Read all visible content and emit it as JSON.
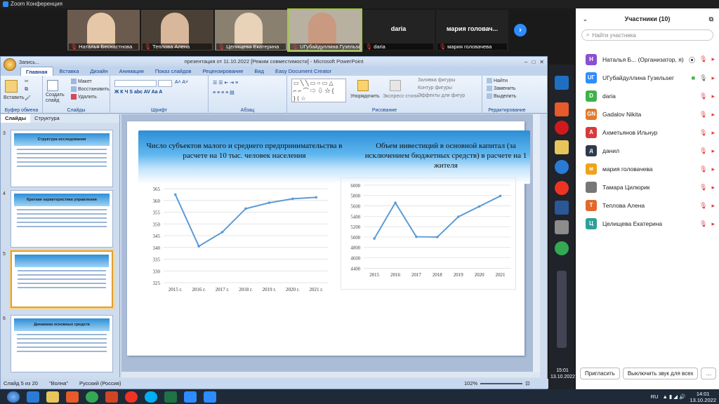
{
  "app": {
    "title": "Zoom Конференция"
  },
  "thumbs": [
    {
      "name": "Наталья Беснастнова",
      "bg": "#6b5a4e",
      "face": "#e6c8a8"
    },
    {
      "name": "Теплова Алена",
      "bg": "#4b4036",
      "face": "#d8b79b"
    },
    {
      "name": "Целищева Екатерина",
      "bg": "#8a8070",
      "face": "#e8d2b8"
    },
    {
      "name": "UГубайдуллина Гузельsег",
      "bg": "#b8b0a0",
      "face": "#c99a80"
    },
    {
      "name": "daria",
      "big": "daria"
    },
    {
      "name": "мария головачева",
      "big": "мария головач..."
    }
  ],
  "ppt": {
    "window_title": "презентация от 11.10.2022 [Режим совместимости] - Microsoft PowerPoint",
    "qat": "Запись...",
    "tabs": [
      "Главная",
      "Вставка",
      "Дизайн",
      "Анимация",
      "Показ слайдов",
      "Рецензирование",
      "Вид",
      "Easy Document Creator"
    ],
    "ribbon": {
      "paste": "Вставить",
      "cut": "",
      "create_slide": "Создать слайд",
      "layout": "Макет",
      "reset": "Восстановить",
      "delete": "Удалить",
      "clipboard": "Буфер обмена",
      "slides": "Слайды",
      "font": "Шрифт",
      "paragraph": "Абзац",
      "drawing": "Рисование",
      "editing": "Редактирование",
      "arrange": "Упорядочить",
      "quick_styles": "Экспресс-стили",
      "fill": "Заливка фигуры",
      "outline": "Контур фигуры",
      "effects": "Эффекты для фигур",
      "find": "Найти",
      "replace": "Заменить",
      "select": "Выделить"
    },
    "left_tabs": [
      "Слайды",
      "Структура"
    ],
    "slides": [
      {
        "num": "3",
        "title": "Структура исследования"
      },
      {
        "num": "4",
        "title": "Краткая характеристика управления"
      },
      {
        "num": "5",
        "title": ""
      },
      {
        "num": "6",
        "title": "Динамика основных средств"
      }
    ],
    "status": {
      "slide": "Слайд 5 из 20",
      "theme": "\"Волна\"",
      "lang": "Русский (Россия)",
      "zoom": "102%"
    }
  },
  "slide": {
    "title_left": "Число субъектов малого и среднего предпринимательства в расчете на 10 тыс. человек населения",
    "title_right": "Объем инвестиций в основной капитал (за исключением бюджетных средств) в расчете на 1 жителя"
  },
  "chart_data": [
    {
      "type": "line",
      "title": "Число субъектов малого и среднего предпринимательства в расчете на 10 тыс. человек населения",
      "categories": [
        "2015 г.",
        "2016 г.",
        "2017 г.",
        "2018 г.",
        "2019 г.",
        "2020 г.",
        "2021 г."
      ],
      "values": [
        362.5,
        340.5,
        346.5,
        356.5,
        359,
        360.7,
        361.3
      ],
      "ylim": [
        325,
        365
      ],
      "yticks": [
        325,
        330,
        335,
        340,
        345,
        350,
        355,
        360,
        365
      ],
      "color": "#5b9bd5",
      "grid": true
    },
    {
      "type": "line",
      "title": "Объем инвестиций в основной капитал (за исключением бюджетных средств) в расчете на 1 жителя",
      "categories": [
        "2015",
        "2016",
        "2017",
        "2018",
        "2019",
        "2020",
        "2021"
      ],
      "values": [
        4970,
        5660,
        5005,
        5000,
        5390,
        5590,
        5790
      ],
      "ylim": [
        4400,
        6000
      ],
      "yticks": [
        4400,
        4600,
        4800,
        5000,
        5200,
        5400,
        5600,
        5800,
        6000
      ],
      "color": "#5b9bd5",
      "grid": true
    }
  ],
  "panel": {
    "title": "Участники (10)",
    "search_placeholder": "Найти участника",
    "invite": "Пригласить",
    "unmute_all": "Выключить звук для всех",
    "participants": [
      {
        "initial": "Н",
        "name": "Наталья Б... (Организатор, я)",
        "color": "#8a4fd0"
      },
      {
        "initial": "UГ",
        "name": "UГубайдуллина Гузельsег",
        "color": "#2d8cff"
      },
      {
        "initial": "D",
        "name": "daria",
        "color": "#3db34a"
      },
      {
        "initial": "GN",
        "name": "Gadalov Nikita",
        "color": "#e07a2d"
      },
      {
        "initial": "А",
        "name": "Ахметьянов Ильнур",
        "color": "#d63b3b"
      },
      {
        "initial": "д",
        "name": "данил",
        "color": "#2f3a4f"
      },
      {
        "initial": "м",
        "name": "мария головачева",
        "color": "#f0a31a"
      },
      {
        "initial": "",
        "name": "Тамара Цилюрик",
        "color": "#777"
      },
      {
        "initial": "Т",
        "name": "Теплова Алена",
        "color": "#e06a2d"
      },
      {
        "initial": "Ц",
        "name": "Целищева Екатерина",
        "color": "#2aa198"
      }
    ]
  },
  "side_clock": {
    "time": "15:01",
    "date": "13.10.2022"
  },
  "taskbar": {
    "lang": "RU",
    "time": "14:01",
    "date": "13.10.2022"
  }
}
